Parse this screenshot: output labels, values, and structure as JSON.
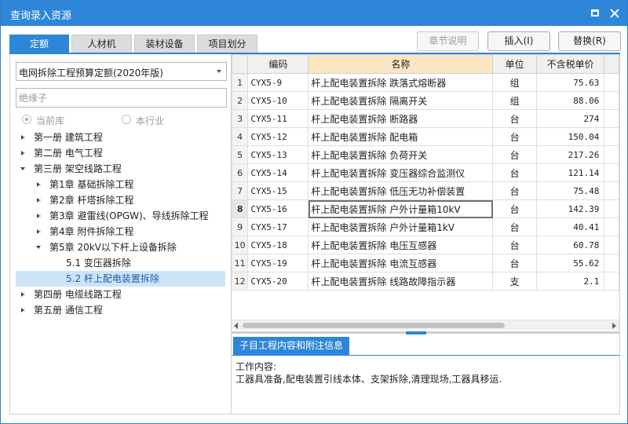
{
  "window": {
    "title": "查询录入资源"
  },
  "tabs": [
    {
      "label": "定额",
      "active": true
    },
    {
      "label": "人材机",
      "active": false
    },
    {
      "label": "装材设备",
      "active": false
    },
    {
      "label": "项目划分",
      "active": false
    }
  ],
  "toolbar": {
    "chapter_note": "章节说明",
    "insert": "插入(I)",
    "replace": "替换(R)"
  },
  "left": {
    "library_select": "电网拆除工程预算定额(2020年版)",
    "search_placeholder": "绝缘子",
    "radio_current": "当前库",
    "radio_industry": "本行业",
    "tree": [
      {
        "label": "第一册 建筑工程",
        "level": 0,
        "expanded": false
      },
      {
        "label": "第二册 电气工程",
        "level": 0,
        "expanded": false
      },
      {
        "label": "第三册 架空线路工程",
        "level": 0,
        "expanded": true
      },
      {
        "label": "第1章 基础拆除工程",
        "level": 1,
        "expanded": false
      },
      {
        "label": "第2章 杆塔拆除工程",
        "level": 1,
        "expanded": false
      },
      {
        "label": "第3章 避雷线(OPGW)、导线拆除工程",
        "level": 1,
        "expanded": false
      },
      {
        "label": "第4章 附件拆除工程",
        "level": 1,
        "expanded": false
      },
      {
        "label": "第5章 20kV以下杆上设备拆除",
        "level": 1,
        "expanded": true
      },
      {
        "label": "5.1 变压器拆除",
        "level": 2,
        "leaf": true
      },
      {
        "label": "5.2 杆上配电装置拆除",
        "level": 2,
        "leaf": true,
        "selected": true
      },
      {
        "label": "第四册 电缆线路工程",
        "level": 0,
        "expanded": false
      },
      {
        "label": "第五册 通信工程",
        "level": 0,
        "expanded": false
      }
    ]
  },
  "grid": {
    "columns": [
      "编码",
      "名称",
      "单位",
      "不含税单价"
    ],
    "current_row": 8,
    "rows": [
      {
        "no": "1",
        "code": "CYX5-9",
        "name": "杆上配电装置拆除 跌落式熔断器",
        "unit": "组",
        "price": "75.63"
      },
      {
        "no": "2",
        "code": "CYX5-10",
        "name": "杆上配电装置拆除 隔离开关",
        "unit": "组",
        "price": "88.06"
      },
      {
        "no": "3",
        "code": "CYX5-11",
        "name": "杆上配电装置拆除 断路器",
        "unit": "台",
        "price": "274"
      },
      {
        "no": "4",
        "code": "CYX5-12",
        "name": "杆上配电装置拆除 配电箱",
        "unit": "台",
        "price": "150.04"
      },
      {
        "no": "5",
        "code": "CYX5-13",
        "name": "杆上配电装置拆除 负荷开关",
        "unit": "台",
        "price": "217.26"
      },
      {
        "no": "6",
        "code": "CYX5-14",
        "name": "杆上配电装置拆除 变压器综合监测仪",
        "unit": "台",
        "price": "121.14"
      },
      {
        "no": "7",
        "code": "CYX5-15",
        "name": "杆上配电装置拆除 低压无功补偿装置",
        "unit": "台",
        "price": "75.48"
      },
      {
        "no": "8",
        "code": "CYX5-16",
        "name": "杆上配电装置拆除 户外计量箱10kV",
        "unit": "台",
        "price": "142.39"
      },
      {
        "no": "9",
        "code": "CYX5-17",
        "name": "杆上配电装置拆除 户外计量箱1kV",
        "unit": "台",
        "price": "40.41"
      },
      {
        "no": "10",
        "code": "CYX5-18",
        "name": "杆上配电装置拆除 电压互感器",
        "unit": "台",
        "price": "60.78"
      },
      {
        "no": "11",
        "code": "CYX5-19",
        "name": "杆上配电装置拆除 电流互感器",
        "unit": "台",
        "price": "55.62"
      },
      {
        "no": "12",
        "code": "CYX5-20",
        "name": "杆上配电装置拆除 线路故障指示器",
        "unit": "支",
        "price": "2.1"
      }
    ]
  },
  "info": {
    "tab_label": "子目工程内容和附注信息",
    "heading": "工作内容:",
    "content": "工器具准备,配电装置引线本体、支架拆除,清理现场,工器具移运."
  }
}
